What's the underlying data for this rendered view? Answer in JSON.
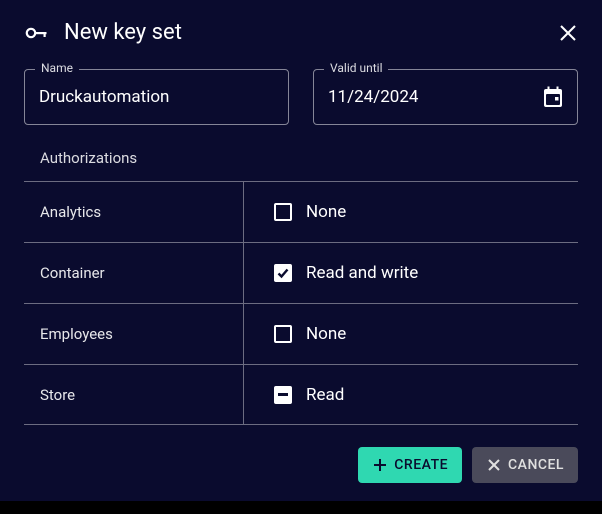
{
  "dialog": {
    "title": "New key set"
  },
  "fields": {
    "name": {
      "label": "Name",
      "value": "Druckautomation"
    },
    "valid_until": {
      "label": "Valid until",
      "value": "11/24/2024"
    }
  },
  "authorizations": {
    "heading": "Authorizations",
    "rows": [
      {
        "resource": "Analytics",
        "permission": "None",
        "state": "unchecked"
      },
      {
        "resource": "Container",
        "permission": "Read and write",
        "state": "checked"
      },
      {
        "resource": "Employees",
        "permission": "None",
        "state": "unchecked"
      },
      {
        "resource": "Store",
        "permission": "Read",
        "state": "indeterminate"
      }
    ]
  },
  "buttons": {
    "create": "CREATE",
    "cancel": "CANCEL"
  }
}
